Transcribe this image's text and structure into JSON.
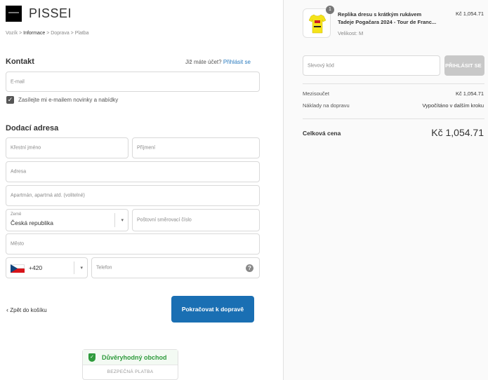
{
  "store": {
    "name": "PISSEI"
  },
  "breadcrumb": {
    "cart": "Vozík",
    "sep": ">",
    "info": "Informace",
    "shipping": "Doprava",
    "payment": "Platba"
  },
  "contact": {
    "heading": "Kontakt",
    "have_account": "Již máte účet?",
    "login_link": "Přihlásit se",
    "email_placeholder": "E-mail",
    "newsletter_label": "Zasílejte mi e-mailem novinky a nabídky",
    "newsletter_checked": true
  },
  "shipping_address": {
    "heading": "Dodací adresa",
    "first_name_placeholder": "Křestní jméno",
    "last_name_placeholder": "Příjmení",
    "address_placeholder": "Adresa",
    "apartment_placeholder": "Apartmán, apartmá atd. (volitelné)",
    "country_label": "Země",
    "country_value": "Česká republika",
    "postal_placeholder": "Poštovní směrovací číslo",
    "city_placeholder": "Město",
    "phone_code": "+420",
    "phone_placeholder": "Telefon"
  },
  "actions": {
    "back_label": "Zpět do košíku",
    "continue_label": "Pokračovat k dopravě"
  },
  "trust_badge": {
    "title": "Důvěryhodný obchod",
    "subtitle": "BEZPEČNÁ PLATBA"
  },
  "order_summary": {
    "item": {
      "quantity": "1",
      "title_line1": "Replika dresu s krátkým rukávem",
      "title_line2": "Tadeje Pogačara 2024 - Tour de Franc...",
      "variant": "Velikost: M",
      "price": "Kč 1,054.71"
    },
    "discount_placeholder": "Slevový kód",
    "discount_button": "PŘIHLÁSIT SE",
    "subtotal_label": "Mezisoučet",
    "subtotal_value": "Kč 1,054.71",
    "shipping_label": "Náklady na dopravu",
    "shipping_value": "Vypočítáno v dalším kroku",
    "total_label": "Celková cena",
    "total_value": "Kč 1,054.71"
  },
  "colors": {
    "primary": "#1a6fb3",
    "link": "#2a7bbf",
    "trust_green": "#2e9b3c",
    "jersey_yellow": "#f5e31a"
  }
}
